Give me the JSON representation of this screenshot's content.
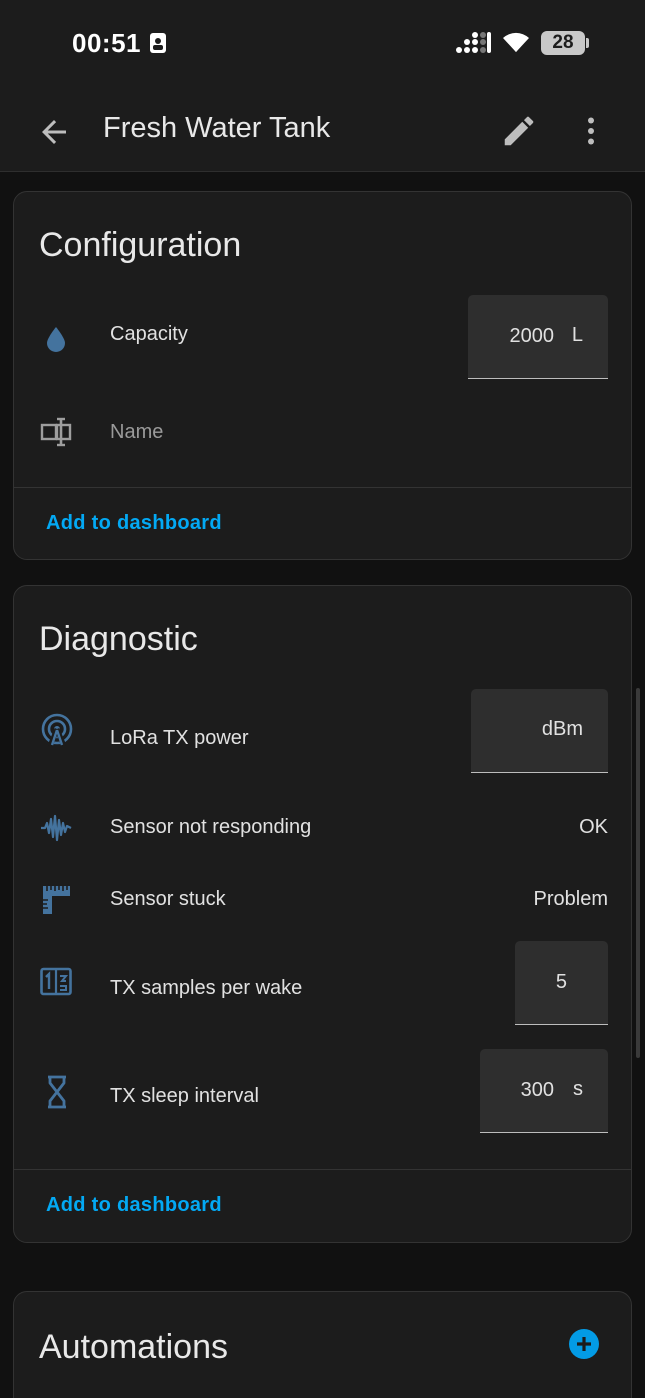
{
  "status_bar": {
    "time": "00:51",
    "battery": "28"
  },
  "app_bar": {
    "title": "Fresh Water Tank",
    "icons": [
      "arrow-left-icon",
      "pencil-icon",
      "dots-vertical-icon"
    ]
  },
  "configuration": {
    "title": "Configuration",
    "capacity": {
      "label": "Capacity",
      "value": "2000",
      "unit": "L",
      "icon": "water-drop-icon"
    },
    "name": {
      "label": "Name",
      "icon": "form-textbox-icon"
    },
    "action": "Add to dashboard"
  },
  "diagnostic": {
    "title": "Diagnostic",
    "tx_power": {
      "label": "LoRa TX power",
      "value": "",
      "unit": "dBm",
      "icon": "access-point-icon"
    },
    "not_responding": {
      "label": "Sensor not responding",
      "state": "OK",
      "icon": "waveform-icon"
    },
    "sensor_stuck": {
      "label": "Sensor stuck",
      "state": "Problem",
      "icon": "ruler-icon"
    },
    "samples": {
      "label": "TX samples per wake",
      "value": "5",
      "icon": "numeric-box-icon"
    },
    "sleep": {
      "label": "TX sleep interval",
      "value": "300",
      "unit": "s",
      "icon": "hourglass-icon"
    },
    "action": "Add to dashboard"
  },
  "automations": {
    "title": "Automations"
  },
  "colors": {
    "accent": "#03a9f4",
    "icon": "#44739e",
    "card": "#1c1c1c",
    "background": "#111111"
  }
}
